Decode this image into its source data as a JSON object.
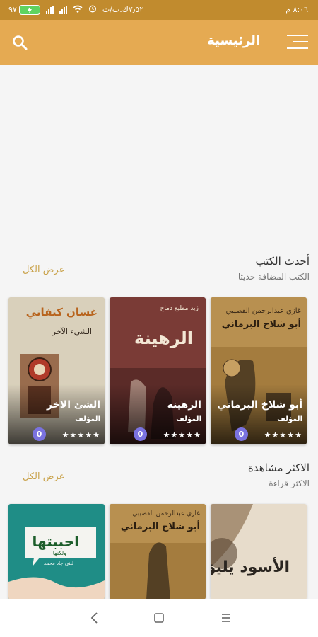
{
  "status_bar": {
    "time": "٨:٠٦ م",
    "battery": "٩٧",
    "speed": "٧٫٥٢ك.ب/ث"
  },
  "header": {
    "title": "الرئيسية",
    "menu_icon": "hamburger-menu-icon",
    "search_icon": "search-icon"
  },
  "sections": [
    {
      "title": "أحدث الكتب",
      "subtitle": "الكتب المضافة حديثا",
      "show_all": "عرض الكل",
      "books": [
        {
          "title": "أبو شلاخ البرماني",
          "author": "المؤلف",
          "rating_count": "0",
          "cover_title": "أبو شلاخ البرماني",
          "cover_author": "غازي عبدالرحمن القصيبي"
        },
        {
          "title": "الرهينة",
          "author": "المؤلف",
          "rating_count": "0",
          "cover_title": "الرهينة",
          "cover_author": "زيد مطيع دماج"
        },
        {
          "title": "الشئ الاخر",
          "author": "المؤلف",
          "rating_count": "0",
          "cover_title": "الشيء الآخر",
          "cover_author": "غسان كنفاني"
        }
      ]
    },
    {
      "title": "الاكثر مشاهدة",
      "subtitle": "الاكثر قراءة",
      "show_all": "عرض الكل",
      "books": [
        {
          "cover_title": "الأسود يليق بك"
        },
        {
          "cover_title": "أبو شلاخ البرماني",
          "cover_author": "غازي عبدالرحمن القصيبي"
        },
        {
          "cover_title": "احببتها",
          "cover_subtitle": "ولكنها",
          "cover_author": "لبنى جاد محمد"
        }
      ]
    }
  ],
  "rating": {
    "stars": "★★★★★"
  },
  "nav": {
    "back_icon": "back-chevron-icon",
    "home_icon": "home-square-icon",
    "recents_icon": "recents-menu-icon"
  }
}
